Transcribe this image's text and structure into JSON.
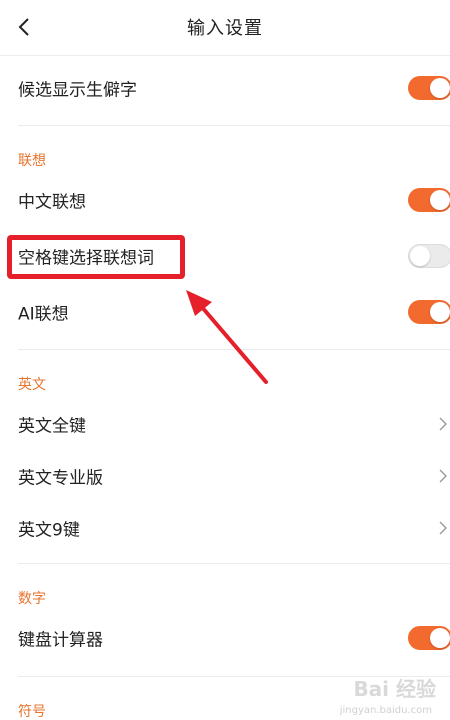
{
  "header": {
    "title": "输入设置",
    "back_icon": "chevron-left-icon"
  },
  "rows": {
    "candidate_rare": {
      "label": "候选显示生僻字",
      "toggle": "on"
    },
    "section_association": "联想",
    "chinese_association": {
      "label": "中文联想",
      "toggle": "on"
    },
    "space_select": {
      "label": "空格键选择联想词",
      "toggle": "off"
    },
    "ai_association": {
      "label": "AI联想",
      "toggle": "on"
    },
    "section_english": "英文",
    "english_full": {
      "label": "英文全键"
    },
    "english_pro": {
      "label": "英文专业版"
    },
    "english_9": {
      "label": "英文9键"
    },
    "section_number": "数字",
    "calculator": {
      "label": "键盘计算器",
      "toggle": "on"
    },
    "section_symbol": "符号"
  },
  "watermark": {
    "brand": "Bai 经验",
    "url": "jingyan.baidu.com"
  },
  "colors": {
    "accent": "#f26a2e",
    "section": "#e8742f",
    "annotation": "#e5202a"
  }
}
